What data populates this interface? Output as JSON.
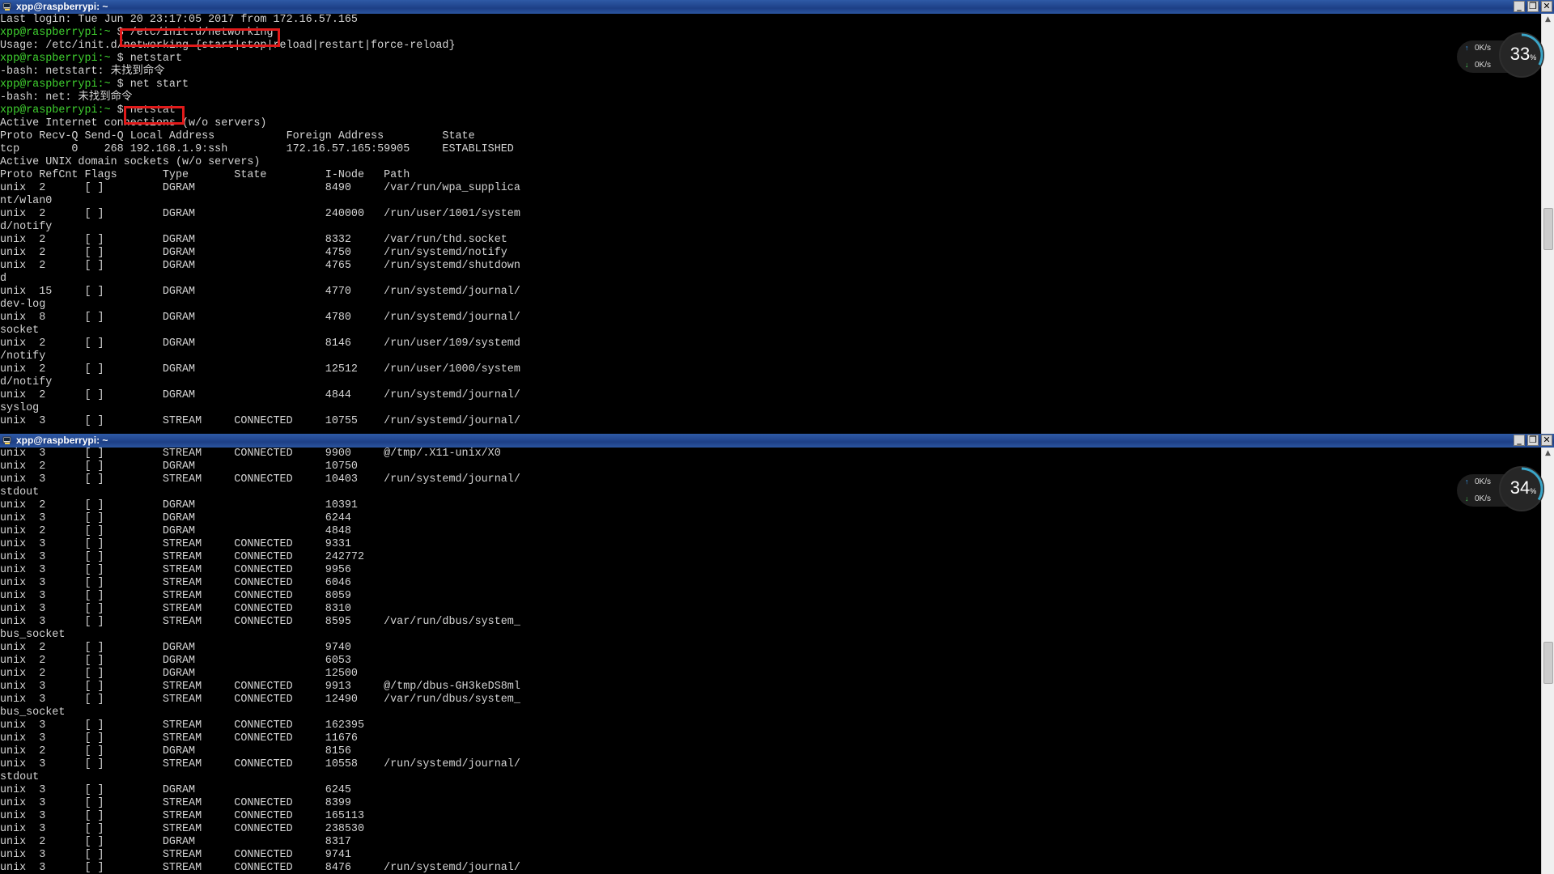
{
  "colors": {
    "prompt": "#3fd12f",
    "text": "#d4d4d4",
    "highlight": "#e01a1a",
    "titlebar": "#1d3f86"
  },
  "windows": [
    {
      "title": "xpp@raspberrypi: ~",
      "lines": [
        "Last login: Tue Jun 20 23:17:05 2017 from 172.16.57.165",
        "xpp@raspberrypi:~ $ /etc/init.d/networking",
        "Usage: /etc/init.d/networking {start|stop|reload|restart|force-reload}",
        "xpp@raspberrypi:~ $ netstart",
        "-bash: netstart: 未找到命令",
        "xpp@raspberrypi:~ $ net start",
        "-bash: net: 未找到命令",
        "xpp@raspberrypi:~ $ netstat",
        "Active Internet connections (w/o servers)",
        "Proto Recv-Q Send-Q Local Address           Foreign Address         State",
        "tcp        0    268 192.168.1.9:ssh         172.16.57.165:59905     ESTABLISHED",
        "Active UNIX domain sockets (w/o servers)",
        "Proto RefCnt Flags       Type       State         I-Node   Path",
        "unix  2      [ ]         DGRAM                    8490     /var/run/wpa_supplica",
        "nt/wlan0",
        "unix  2      [ ]         DGRAM                    240000   /run/user/1001/system",
        "d/notify",
        "unix  2      [ ]         DGRAM                    8332     /var/run/thd.socket",
        "unix  2      [ ]         DGRAM                    4750     /run/systemd/notify",
        "unix  2      [ ]         DGRAM                    4765     /run/systemd/shutdown",
        "d",
        "unix  15     [ ]         DGRAM                    4770     /run/systemd/journal/",
        "dev-log",
        "unix  8      [ ]         DGRAM                    4780     /run/systemd/journal/",
        "socket",
        "unix  2      [ ]         DGRAM                    8146     /run/user/109/systemd",
        "/notify",
        "unix  2      [ ]         DGRAM                    12512    /run/user/1000/system",
        "d/notify",
        "unix  2      [ ]         DGRAM                    4844     /run/systemd/journal/",
        "syslog",
        "unix  3      [ ]         STREAM     CONNECTED     10755    /run/systemd/journal/"
      ],
      "monitor": {
        "up": "0K/s",
        "down": "0K/s",
        "value": "33",
        "unit": "%",
        "level": 0.33
      }
    },
    {
      "title": "xpp@raspberrypi: ~",
      "lines": [
        "unix  3      [ ]         STREAM     CONNECTED     9900     @/tmp/.X11-unix/X0",
        "unix  2      [ ]         DGRAM                    10750",
        "unix  3      [ ]         STREAM     CONNECTED     10403    /run/systemd/journal/",
        "stdout",
        "unix  2      [ ]         DGRAM                    10391",
        "unix  3      [ ]         DGRAM                    6244",
        "unix  2      [ ]         DGRAM                    4848",
        "unix  3      [ ]         STREAM     CONNECTED     9331",
        "unix  3      [ ]         STREAM     CONNECTED     242772",
        "unix  3      [ ]         STREAM     CONNECTED     9956",
        "unix  3      [ ]         STREAM     CONNECTED     6046",
        "unix  3      [ ]         STREAM     CONNECTED     8059",
        "unix  3      [ ]         STREAM     CONNECTED     8310",
        "unix  3      [ ]         STREAM     CONNECTED     8595     /var/run/dbus/system_",
        "bus_socket",
        "unix  2      [ ]         DGRAM                    9740",
        "unix  2      [ ]         DGRAM                    6053",
        "unix  2      [ ]         DGRAM                    12500",
        "unix  3      [ ]         STREAM     CONNECTED     9913     @/tmp/dbus-GH3keDS8ml",
        "unix  3      [ ]         STREAM     CONNECTED     12490    /var/run/dbus/system_",
        "bus_socket",
        "unix  3      [ ]         STREAM     CONNECTED     162395",
        "unix  3      [ ]         STREAM     CONNECTED     11676",
        "unix  2      [ ]         DGRAM                    8156",
        "unix  3      [ ]         STREAM     CONNECTED     10558    /run/systemd/journal/",
        "stdout",
        "unix  3      [ ]         DGRAM                    6245",
        "unix  3      [ ]         STREAM     CONNECTED     8399",
        "unix  3      [ ]         STREAM     CONNECTED     165113",
        "unix  3      [ ]         STREAM     CONNECTED     238530",
        "unix  2      [ ]         DGRAM                    8317",
        "unix  3      [ ]         STREAM     CONNECTED     9741",
        "unix  3      [ ]         STREAM     CONNECTED     8476     /run/systemd/journal/"
      ],
      "monitor": {
        "up": "0K/s",
        "down": "0K/s",
        "value": "34",
        "unit": "%",
        "level": 0.34
      }
    }
  ]
}
